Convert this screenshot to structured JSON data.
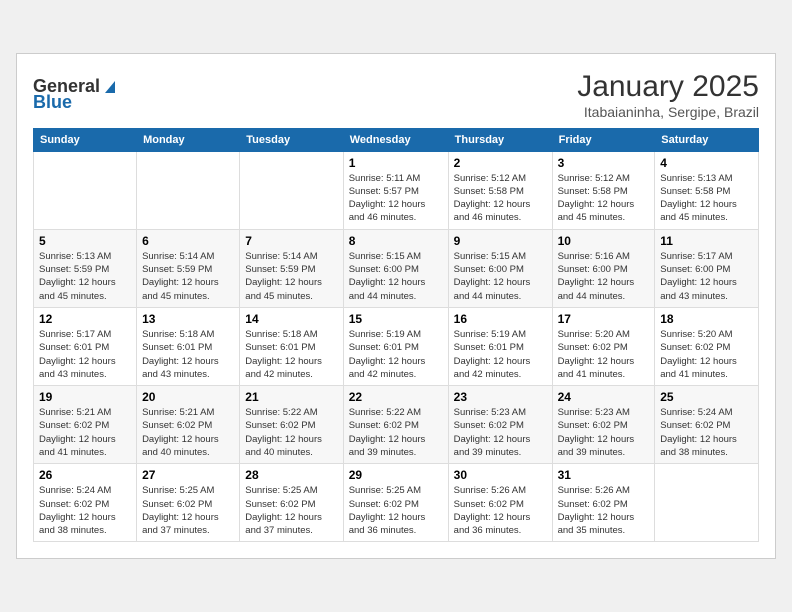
{
  "header": {
    "logo_general": "General",
    "logo_blue": "Blue",
    "title": "January 2025",
    "subtitle": "Itabaianinha, Sergipe, Brazil"
  },
  "weekdays": [
    "Sunday",
    "Monday",
    "Tuesday",
    "Wednesday",
    "Thursday",
    "Friday",
    "Saturday"
  ],
  "weeks": [
    [
      {
        "day": "",
        "info": ""
      },
      {
        "day": "",
        "info": ""
      },
      {
        "day": "",
        "info": ""
      },
      {
        "day": "1",
        "info": "Sunrise: 5:11 AM\nSunset: 5:57 PM\nDaylight: 12 hours\nand 46 minutes."
      },
      {
        "day": "2",
        "info": "Sunrise: 5:12 AM\nSunset: 5:58 PM\nDaylight: 12 hours\nand 46 minutes."
      },
      {
        "day": "3",
        "info": "Sunrise: 5:12 AM\nSunset: 5:58 PM\nDaylight: 12 hours\nand 45 minutes."
      },
      {
        "day": "4",
        "info": "Sunrise: 5:13 AM\nSunset: 5:58 PM\nDaylight: 12 hours\nand 45 minutes."
      }
    ],
    [
      {
        "day": "5",
        "info": "Sunrise: 5:13 AM\nSunset: 5:59 PM\nDaylight: 12 hours\nand 45 minutes."
      },
      {
        "day": "6",
        "info": "Sunrise: 5:14 AM\nSunset: 5:59 PM\nDaylight: 12 hours\nand 45 minutes."
      },
      {
        "day": "7",
        "info": "Sunrise: 5:14 AM\nSunset: 5:59 PM\nDaylight: 12 hours\nand 45 minutes."
      },
      {
        "day": "8",
        "info": "Sunrise: 5:15 AM\nSunset: 6:00 PM\nDaylight: 12 hours\nand 44 minutes."
      },
      {
        "day": "9",
        "info": "Sunrise: 5:15 AM\nSunset: 6:00 PM\nDaylight: 12 hours\nand 44 minutes."
      },
      {
        "day": "10",
        "info": "Sunrise: 5:16 AM\nSunset: 6:00 PM\nDaylight: 12 hours\nand 44 minutes."
      },
      {
        "day": "11",
        "info": "Sunrise: 5:17 AM\nSunset: 6:00 PM\nDaylight: 12 hours\nand 43 minutes."
      }
    ],
    [
      {
        "day": "12",
        "info": "Sunrise: 5:17 AM\nSunset: 6:01 PM\nDaylight: 12 hours\nand 43 minutes."
      },
      {
        "day": "13",
        "info": "Sunrise: 5:18 AM\nSunset: 6:01 PM\nDaylight: 12 hours\nand 43 minutes."
      },
      {
        "day": "14",
        "info": "Sunrise: 5:18 AM\nSunset: 6:01 PM\nDaylight: 12 hours\nand 42 minutes."
      },
      {
        "day": "15",
        "info": "Sunrise: 5:19 AM\nSunset: 6:01 PM\nDaylight: 12 hours\nand 42 minutes."
      },
      {
        "day": "16",
        "info": "Sunrise: 5:19 AM\nSunset: 6:01 PM\nDaylight: 12 hours\nand 42 minutes."
      },
      {
        "day": "17",
        "info": "Sunrise: 5:20 AM\nSunset: 6:02 PM\nDaylight: 12 hours\nand 41 minutes."
      },
      {
        "day": "18",
        "info": "Sunrise: 5:20 AM\nSunset: 6:02 PM\nDaylight: 12 hours\nand 41 minutes."
      }
    ],
    [
      {
        "day": "19",
        "info": "Sunrise: 5:21 AM\nSunset: 6:02 PM\nDaylight: 12 hours\nand 41 minutes."
      },
      {
        "day": "20",
        "info": "Sunrise: 5:21 AM\nSunset: 6:02 PM\nDaylight: 12 hours\nand 40 minutes."
      },
      {
        "day": "21",
        "info": "Sunrise: 5:22 AM\nSunset: 6:02 PM\nDaylight: 12 hours\nand 40 minutes."
      },
      {
        "day": "22",
        "info": "Sunrise: 5:22 AM\nSunset: 6:02 PM\nDaylight: 12 hours\nand 39 minutes."
      },
      {
        "day": "23",
        "info": "Sunrise: 5:23 AM\nSunset: 6:02 PM\nDaylight: 12 hours\nand 39 minutes."
      },
      {
        "day": "24",
        "info": "Sunrise: 5:23 AM\nSunset: 6:02 PM\nDaylight: 12 hours\nand 39 minutes."
      },
      {
        "day": "25",
        "info": "Sunrise: 5:24 AM\nSunset: 6:02 PM\nDaylight: 12 hours\nand 38 minutes."
      }
    ],
    [
      {
        "day": "26",
        "info": "Sunrise: 5:24 AM\nSunset: 6:02 PM\nDaylight: 12 hours\nand 38 minutes."
      },
      {
        "day": "27",
        "info": "Sunrise: 5:25 AM\nSunset: 6:02 PM\nDaylight: 12 hours\nand 37 minutes."
      },
      {
        "day": "28",
        "info": "Sunrise: 5:25 AM\nSunset: 6:02 PM\nDaylight: 12 hours\nand 37 minutes."
      },
      {
        "day": "29",
        "info": "Sunrise: 5:25 AM\nSunset: 6:02 PM\nDaylight: 12 hours\nand 36 minutes."
      },
      {
        "day": "30",
        "info": "Sunrise: 5:26 AM\nSunset: 6:02 PM\nDaylight: 12 hours\nand 36 minutes."
      },
      {
        "day": "31",
        "info": "Sunrise: 5:26 AM\nSunset: 6:02 PM\nDaylight: 12 hours\nand 35 minutes."
      },
      {
        "day": "",
        "info": ""
      }
    ]
  ]
}
